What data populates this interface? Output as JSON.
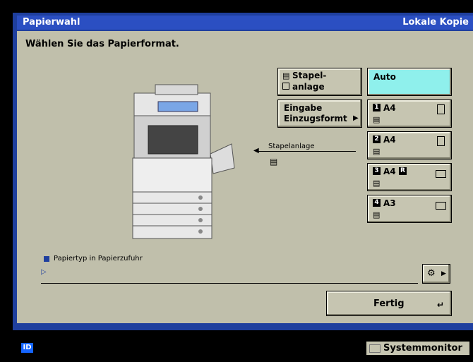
{
  "window": {
    "title": "Papierwahl",
    "mode": "Lokale Kopie"
  },
  "instruction": "Wählen Sie das Papierformat.",
  "left_buttons": {
    "stack_line1": "Stapel-",
    "stack_line2": "anlage",
    "input_line1": "Eingabe",
    "input_line2": "Einzugsformt"
  },
  "stack_label": "Stapelanlage",
  "sources": [
    {
      "label": "Auto",
      "selected": true
    },
    {
      "num": "1",
      "label": "A4",
      "orientation": "portrait"
    },
    {
      "num": "2",
      "label": "A4",
      "orientation": "portrait"
    },
    {
      "num": "3",
      "label": "A4",
      "suffix": "R",
      "orientation": "landscape"
    },
    {
      "num": "4",
      "label": "A3",
      "orientation": "landscape"
    }
  ],
  "papertype_label": "Papiertyp in Papierzufuhr",
  "done_label": "Fertig",
  "status": {
    "id": "ID",
    "monitor": "Systemmonitor"
  },
  "colors": {
    "accent": "#2b4fc2",
    "selected": "#8ff0ec",
    "panel": "#c0bfab"
  }
}
